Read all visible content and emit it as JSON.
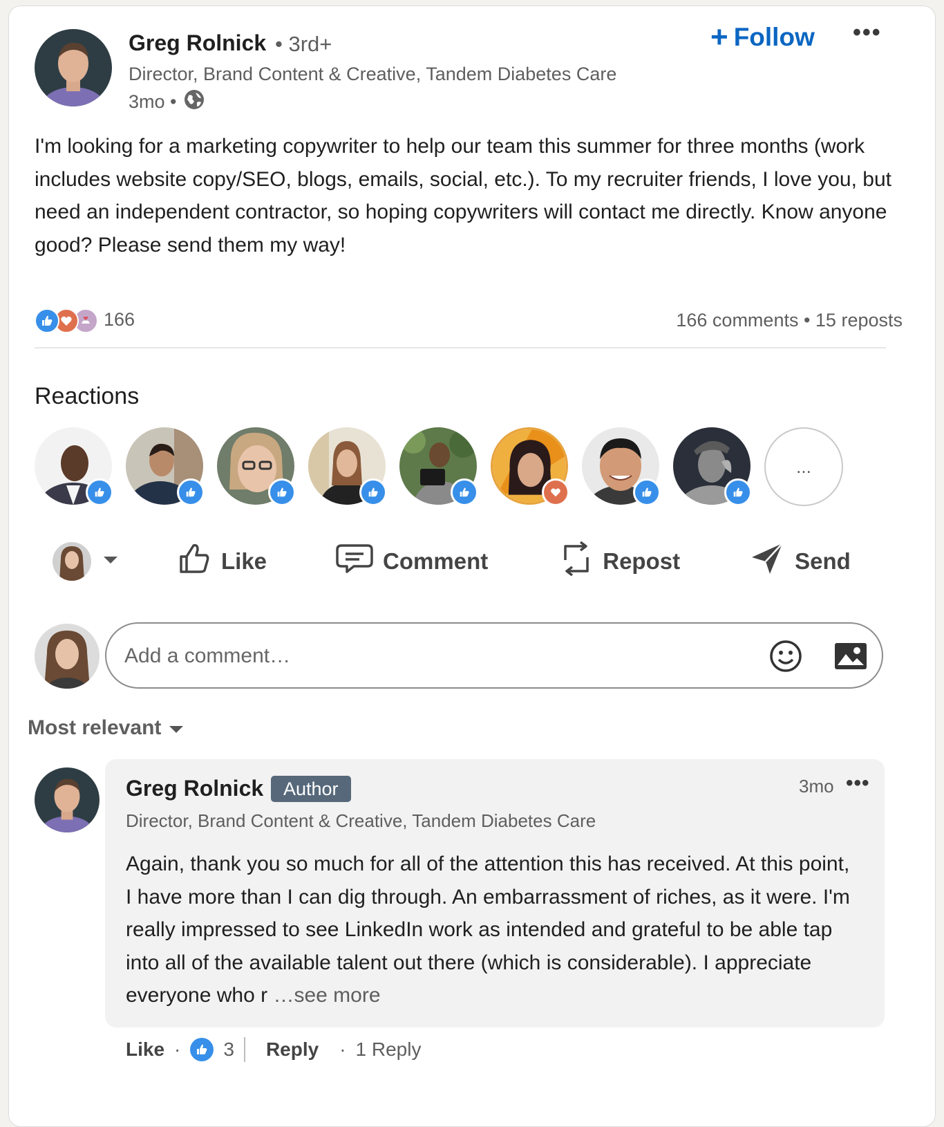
{
  "post": {
    "author_name": "Greg Rolnick",
    "degree": "• 3rd+",
    "headline": "Director, Brand Content & Creative, Tandem Diabetes Care",
    "time": "3mo •",
    "follow_label": "Follow",
    "follow_plus": "+",
    "more_label": "•••",
    "text": "I'm looking for a marketing copywriter to help our team this summer for three months (work includes website copy/SEO, blogs, emails, social, etc.). To my recruiter friends, I love you, but need an independent contractor, so hoping copywriters will contact me directly. Know anyone good? Please send them my way!",
    "reaction_count": "166",
    "comments_reposts": "166 comments • 15 reposts"
  },
  "reactions": {
    "title": "Reactions",
    "more_label": "...",
    "people": [
      {
        "type": "like",
        "icon": "like-icon",
        "color": "#378fe9"
      },
      {
        "type": "like",
        "icon": "like-icon",
        "color": "#378fe9"
      },
      {
        "type": "like",
        "icon": "like-icon",
        "color": "#378fe9"
      },
      {
        "type": "like",
        "icon": "like-icon",
        "color": "#378fe9"
      },
      {
        "type": "like",
        "icon": "like-icon",
        "color": "#378fe9"
      },
      {
        "type": "love",
        "icon": "heart-icon",
        "color": "#df704d"
      },
      {
        "type": "like",
        "icon": "like-icon",
        "color": "#378fe9"
      },
      {
        "type": "like",
        "icon": "like-icon",
        "color": "#378fe9"
      }
    ]
  },
  "actions": {
    "like": "Like",
    "comment": "Comment",
    "repost": "Repost",
    "send": "Send"
  },
  "composer": {
    "placeholder": "Add a comment…"
  },
  "sort": {
    "label": "Most relevant"
  },
  "comment": {
    "author_name": "Greg Rolnick",
    "badge": "Author",
    "time": "3mo",
    "more_label": "•••",
    "headline": "Director, Brand Content & Creative, Tandem Diabetes Care",
    "text": "Again, thank you so much for all of the attention this has received. At this point, I have more than I can dig through. An embarrassment of riches, as it were. I'm really impressed to see LinkedIn work as intended and grateful to be able tap into all of the available talent out there (which is considerable). I appreciate everyone who r",
    "see_more": "…see more",
    "like_label": "Like",
    "dot": "·",
    "like_count": "3",
    "reply_label": "Reply",
    "replies": "1 Reply"
  },
  "colors": {
    "brand_blue": "#0a66c2",
    "like_blue": "#378fe9",
    "love_red": "#df704d",
    "author_badge": "#56687a"
  }
}
